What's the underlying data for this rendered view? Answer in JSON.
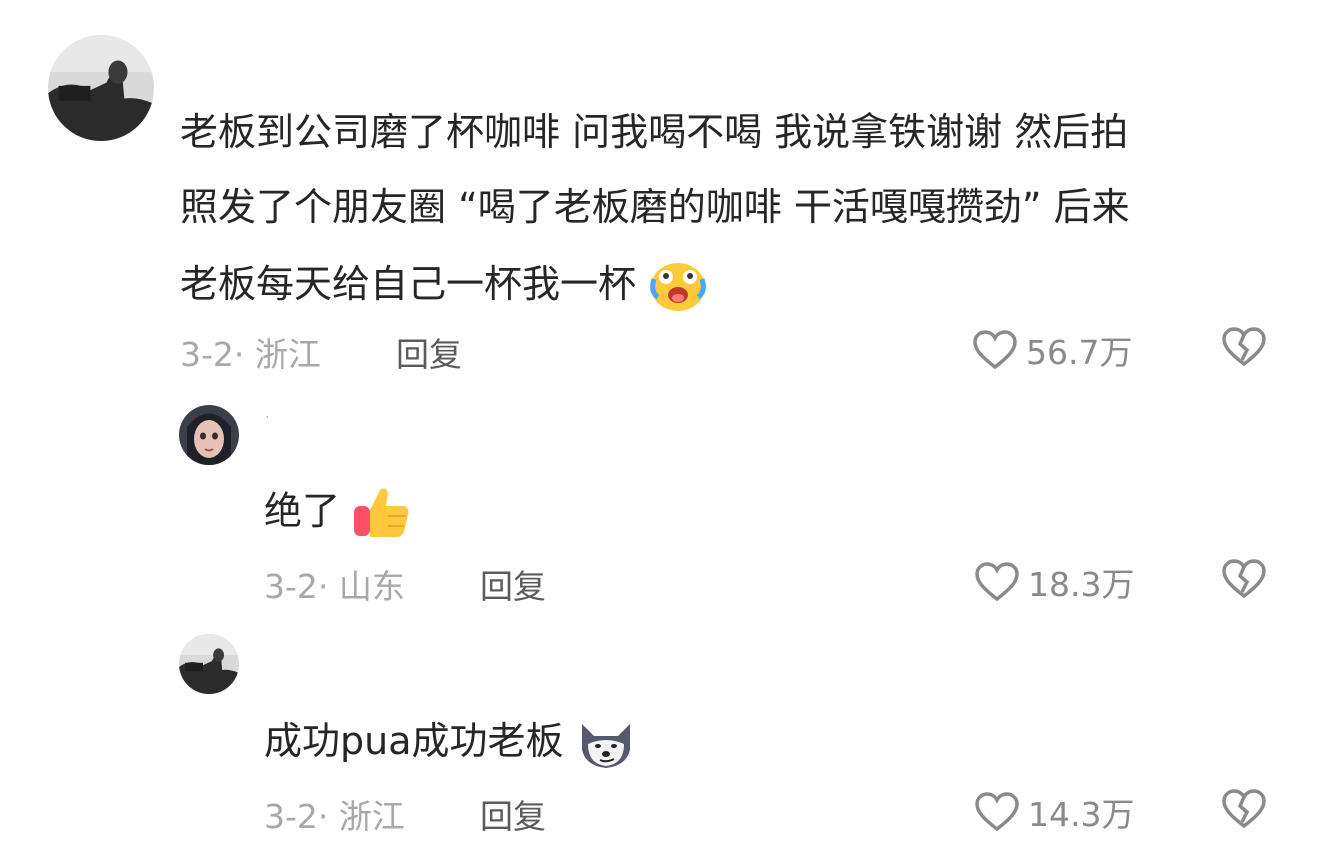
{
  "comments": [
    {
      "text_lines": [
        "老板到公司磨了杯咖啡 问我喝不喝 我说拿铁谢谢 然后拍",
        "照发了个朋友圈 “喝了老板磨的咖啡 干活嘎嘎攒劲” 后来",
        "老板每天给自己一杯我一杯"
      ],
      "emoji": "crying-laughing-emoji",
      "meta": "3-2· 浙江",
      "reply": "回复",
      "likes": "56.7万"
    },
    {
      "username": "·",
      "text": "绝了",
      "emoji": "thumbs-up-emoji",
      "meta": "3-2· 山东",
      "reply": "回复",
      "likes": "18.3万"
    },
    {
      "text": "成功pua成功老板",
      "emoji": "wolf-emoji",
      "meta": "3-2· 浙江",
      "reply": "回复",
      "likes": "14.3万"
    }
  ],
  "colors": {
    "meta": "#a8a8a8",
    "reply": "#5b5b5b",
    "like_count": "#8a8a8a",
    "text": "#262626"
  }
}
